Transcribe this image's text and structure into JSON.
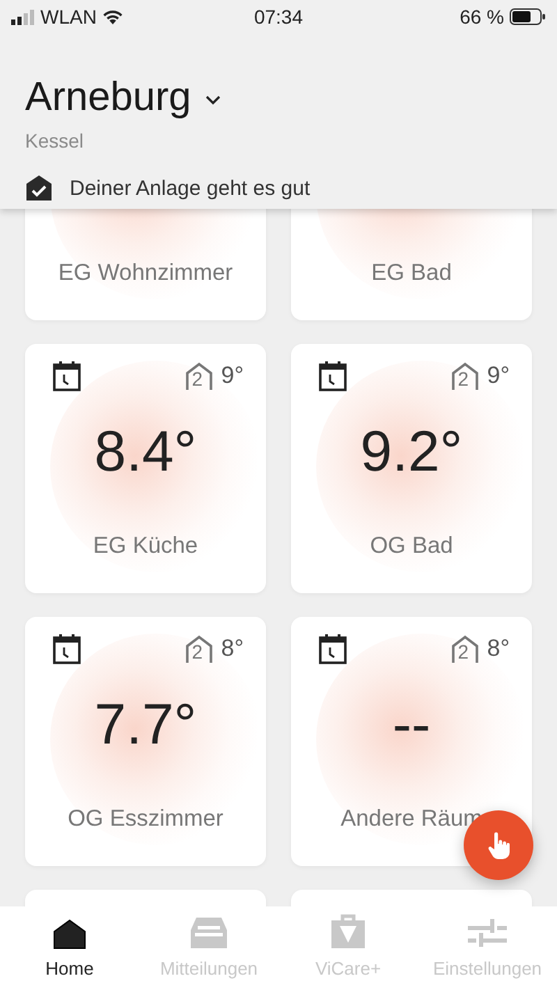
{
  "status_bar": {
    "carrier": "WLAN",
    "time": "07:34",
    "battery": "66 %"
  },
  "header": {
    "title": "Arneburg",
    "subtitle": "Kessel",
    "status": "Deiner Anlage geht es gut"
  },
  "rooms": [
    {
      "kind": "scrolled",
      "name": "EG Wohnzimmer"
    },
    {
      "kind": "scrolled",
      "name": "EG Bad"
    },
    {
      "kind": "full",
      "name": "EG Küche",
      "temperature": "8.4°",
      "floor": "2",
      "setpoint": "9°"
    },
    {
      "kind": "full",
      "name": "OG Bad",
      "temperature": "9.2°",
      "floor": "2",
      "setpoint": "9°"
    },
    {
      "kind": "full",
      "name": "OG Esszimmer",
      "temperature": "7.7°",
      "floor": "2",
      "setpoint": "8°"
    },
    {
      "kind": "full",
      "name": "Andere Räum",
      "temperature": "--",
      "floor": "2",
      "setpoint": "8°"
    },
    {
      "kind": "hidden"
    },
    {
      "kind": "hidden"
    }
  ],
  "tabs": [
    {
      "label": "Home",
      "selected": true
    },
    {
      "label": "Mitteilungen",
      "selected": false
    },
    {
      "label": "ViCare+",
      "selected": false
    },
    {
      "label": "Einstellungen",
      "selected": false
    }
  ]
}
